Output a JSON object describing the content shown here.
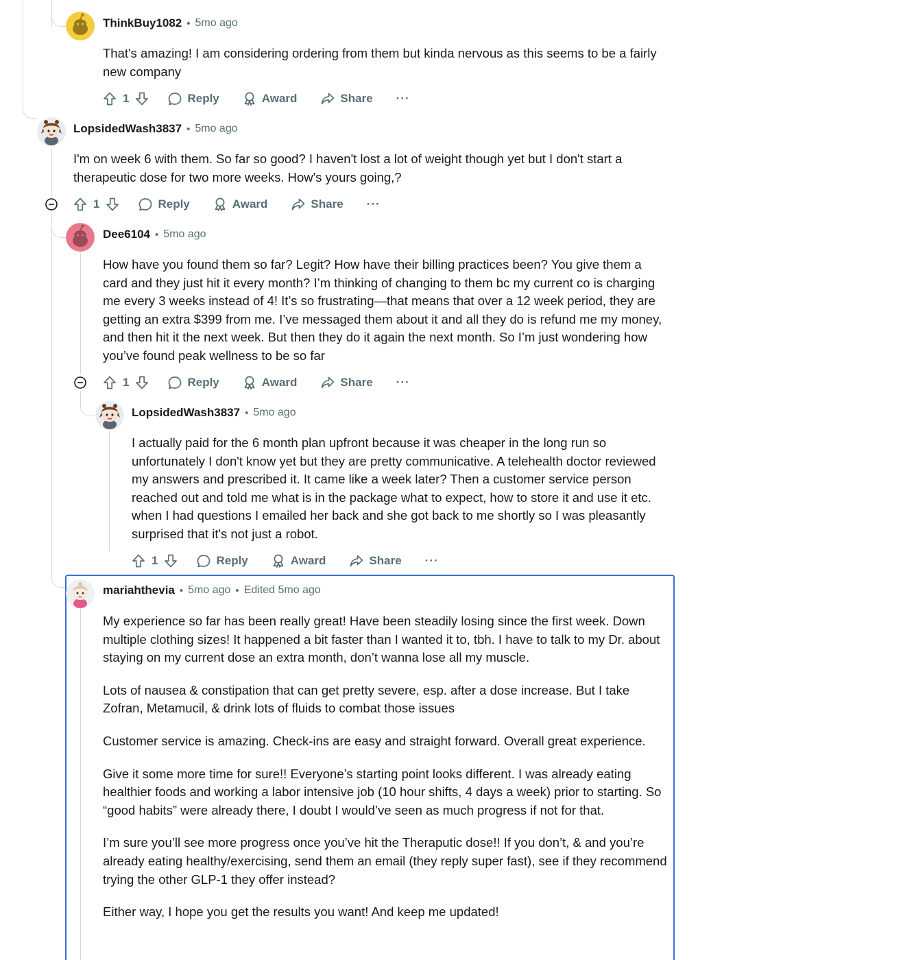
{
  "comments": [
    {
      "author": "ThinkBuy1082",
      "time": "5mo ago",
      "avatar": "snoo-yellow-icon",
      "paragraphs": [
        "That's amazing! I am considering ordering from them but kinda nervous as this seems to be a fairly new company"
      ],
      "votes": "1"
    },
    {
      "author": "LopsidedWash3837",
      "time": "5mo ago",
      "avatar": "snoo-custom-icon",
      "paragraphs": [
        "I'm on week 6 with them. So far so good? I haven't lost a lot of weight though yet but I don't start a therapeutic dose for two more weeks. How's yours going,?"
      ],
      "votes": "1"
    },
    {
      "author": "Dee6104",
      "time": "5mo ago",
      "avatar": "snoo-pink-icon",
      "paragraphs": [
        "How have you found them so far? Legit? How have their billing practices been? You give them a card and they just hit it every month? I’m thinking of changing to them bc my current co is charging me every 3 weeks instead of 4! It’s so frustrating—that means that over a 12 week period, they are getting an extra $399 from me. I’ve messaged them about it and all they do is refund me my money, and then hit it the next week. But then they do it again the next month. So I’m just wondering how you’ve found peak wellness to be so far"
      ],
      "votes": "1"
    },
    {
      "author": "LopsidedWash3837",
      "time": "5mo ago",
      "avatar": "snoo-custom-icon",
      "paragraphs": [
        "I actually paid for the 6 month plan upfront because it was cheaper in the long run so unfortunately I don't know yet but they are pretty communicative. A telehealth doctor reviewed my answers and prescribed it. It came like a week later? Then a customer service person reached out and told me what is in the package what to expect, how to store it and use it etc. when I had questions I emailed her back and she got back to me shortly so I was pleasantly surprised that it's not just a robot."
      ],
      "votes": "1"
    },
    {
      "author": "mariahthevia",
      "time": "5mo ago",
      "edited": "Edited 5mo ago",
      "avatar": "snoo-custom-icon",
      "paragraphs": [
        "My experience so far has been really great! Have been steadily losing since the first week. Down multiple clothing sizes! It happened a bit faster than I wanted it to, tbh. I have to talk to my Dr. about staying on my current dose an extra month, don’t wanna lose all my muscle.",
        "Lots of nausea & constipation that can get pretty severe, esp. after a dose increase. But I take Zofran, Metamucil, & drink lots of fluids to combat those issues",
        "Customer service is amazing. Check-ins are easy and straight forward. Overall great experience.",
        "Give it some more time for sure!! Everyone’s starting point looks different. I was already eating healthier foods and working a labor intensive job (10 hour shifts, 4 days a week) prior to starting. So “good habits” were already there, I doubt I would’ve seen as much progress if not for that.",
        "I’m sure you’ll see more progress once you’ve hit the Theraputic dose!! If you don’t, & and you’re already eating healthy/exercising, send them an email (they reply super fast), see if they recommend trying the other GLP-1 they offer instead?",
        "Either way, I hope you get the results you want! And keep me updated!"
      ]
    }
  ],
  "actions": {
    "reply": "Reply",
    "award": "Award",
    "share": "Share",
    "more": "···"
  },
  "separator": "•",
  "colors": {
    "meta_text": "#576f76",
    "thread_line": "#d7dadc",
    "highlight_border": "#3a6ed6"
  }
}
